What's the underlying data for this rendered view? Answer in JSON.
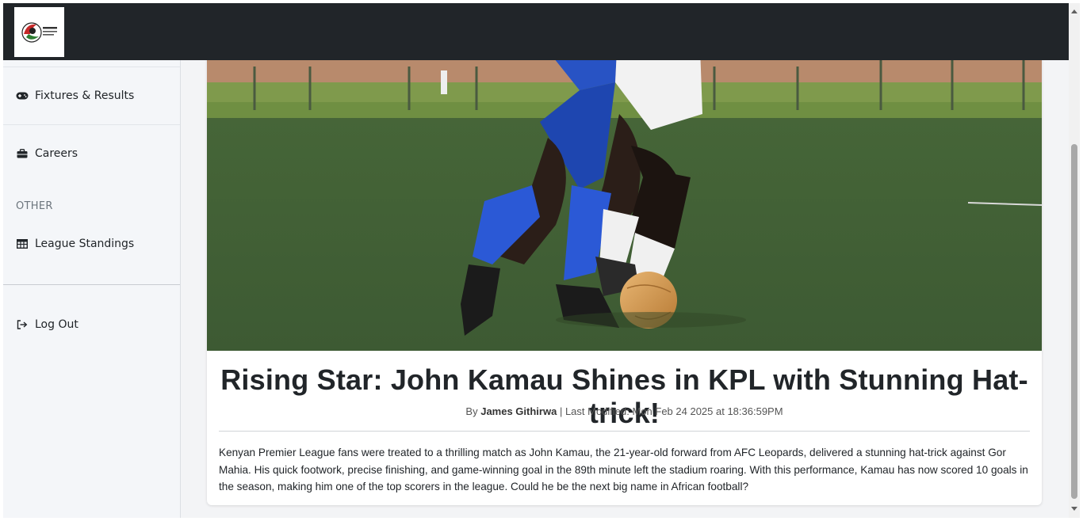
{
  "sidebar": {
    "items": [
      {
        "label": "Fixtures & Results",
        "icon": "gamepad-icon"
      },
      {
        "label": "Careers",
        "icon": "briefcase-icon"
      },
      {
        "label": "League Standings",
        "icon": "table-icon"
      },
      {
        "label": "Log Out",
        "icon": "sign-out-icon"
      }
    ],
    "section_heading": "OTHER"
  },
  "article": {
    "title": "Rising Star: John Kamau Shines in KPL with Stunning Hat-trick!",
    "by_prefix": "By",
    "author": "James Githirwa",
    "modified": "| Last Modified: Mon Feb 24 2025 at 18:36:59PM",
    "body": "Kenyan Premier League fans were treated to a thrilling match as John Kamau, the 21-year-old forward from AFC Leopards, delivered a stunning hat-trick against Gor Mahia. His quick footwork, precise finishing, and game-winning goal in the 89th minute left the stadium roaring. With this performance, Kamau has now scored 10 goals in the season, making him one of the top scorers in the league. Could he be the next big name in African football?"
  },
  "logo": {
    "text_line1": "FKF",
    "text_line2": "PREMIER",
    "text_line3": "LEAGUE"
  },
  "colors": {
    "topbar": "#212529",
    "sidebar": "#f4f6f9",
    "accent_red": "#d32f2f",
    "accent_green": "#2e7d32"
  }
}
